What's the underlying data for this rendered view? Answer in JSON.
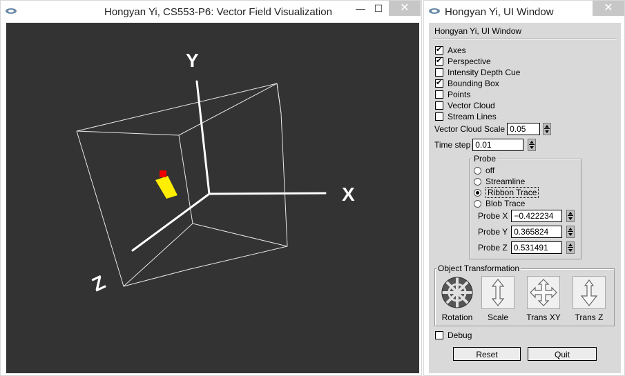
{
  "gl_window": {
    "title": "Hongyan Yi, CS553-P6: Vector Field Visualization",
    "icon": "window-app-icon",
    "buttons": {
      "minimize": "—",
      "maximize": "☐",
      "close": "✕"
    },
    "axis_labels": {
      "x": "X",
      "y": "Y",
      "z": "Z"
    },
    "colors": {
      "background": "#333333",
      "lines": "#ffffff",
      "probe_ribbon": "#ffee00",
      "probe_head": "#ee0000"
    }
  },
  "ui_window": {
    "title": "Hongyan Yi, UI Window",
    "header": "Hongyan Yi, UI Window",
    "buttons": {
      "minimize": "—",
      "maximize": "☐",
      "close": "✕"
    },
    "checkboxes": [
      {
        "label": "Axes",
        "checked": true
      },
      {
        "label": "Perspective",
        "checked": true
      },
      {
        "label": "Intensity Depth Cue",
        "checked": false
      },
      {
        "label": "Bounding Box",
        "checked": true
      },
      {
        "label": "Points",
        "checked": false
      },
      {
        "label": "Vector Cloud",
        "checked": false
      },
      {
        "label": "Stream Lines",
        "checked": false
      }
    ],
    "vector_cloud_scale": {
      "label": "Vector Cloud Scale",
      "value": "0.05"
    },
    "time_step": {
      "label": "Time step",
      "value": "0.01"
    },
    "probe": {
      "title": "Probe",
      "options": [
        {
          "label": "off",
          "selected": false
        },
        {
          "label": "Streamline",
          "selected": false
        },
        {
          "label": "Ribbon Trace",
          "selected": true
        },
        {
          "label": "Blob Trace",
          "selected": false
        }
      ],
      "x": {
        "label": "Probe X",
        "value": "−0.422234"
      },
      "y": {
        "label": "Probe Y",
        "value": "0.365824"
      },
      "z": {
        "label": "Probe Z",
        "value": "0.531491"
      }
    },
    "transformation": {
      "title": "Object Transformation",
      "items": [
        {
          "label": "Rotation",
          "icon": "rotation-sphere-icon"
        },
        {
          "label": "Scale",
          "icon": "scale-arrows-icon"
        },
        {
          "label": "Trans XY",
          "icon": "translate-xy-icon"
        },
        {
          "label": "Trans Z",
          "icon": "translate-z-icon"
        }
      ]
    },
    "debug": {
      "label": "Debug",
      "checked": false
    },
    "reset_label": "Reset",
    "quit_label": "Quit"
  }
}
